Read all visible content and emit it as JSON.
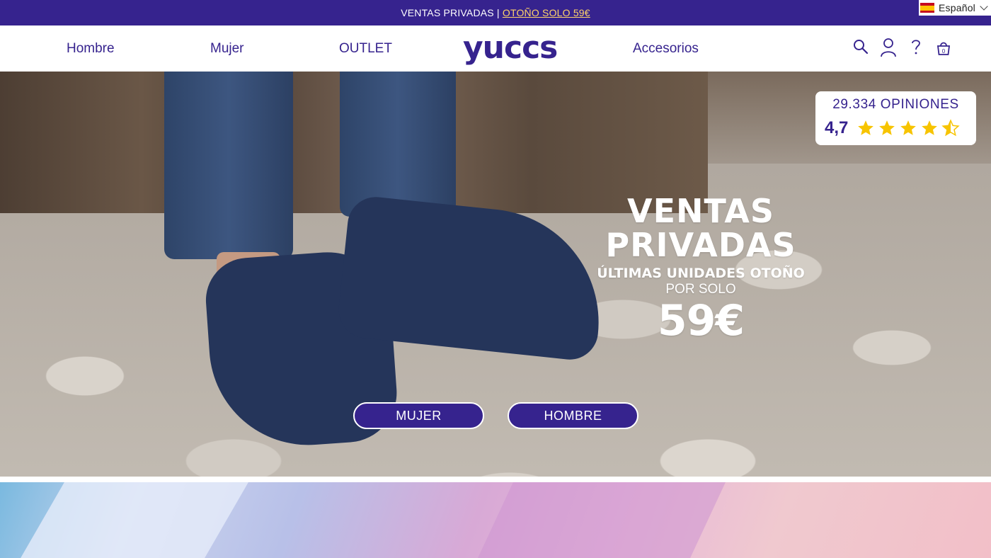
{
  "topbar": {
    "promo_text": "VENTAS PRIVADAS | ",
    "promo_link": "OTOÑO SOLO 59€",
    "language": "Español",
    "flag_icon": "spain-flag-icon"
  },
  "nav": {
    "items": [
      "Hombre",
      "Mujer",
      "OUTLET",
      "Accesorios"
    ],
    "logo": "yuccs",
    "icons": [
      "search-icon",
      "user-icon",
      "help-icon",
      "cart-icon"
    ],
    "cart_count": "0"
  },
  "hero": {
    "rating": {
      "count_label": "29.334 OPINIONES",
      "score": "4,7",
      "stars_value": 4.7
    },
    "headline": {
      "line1": "VENTAS",
      "line2": "PRIVADAS",
      "subtitle": "ÚLTIMAS UNIDADES OTOÑO",
      "price_prefix": "POR SOLO",
      "price": "59€"
    },
    "buttons": {
      "women": "MUJER",
      "men": "HOMBRE"
    }
  },
  "colors": {
    "brand": "#36238e",
    "accent": "#ffd36a",
    "star": "#f7c400"
  }
}
